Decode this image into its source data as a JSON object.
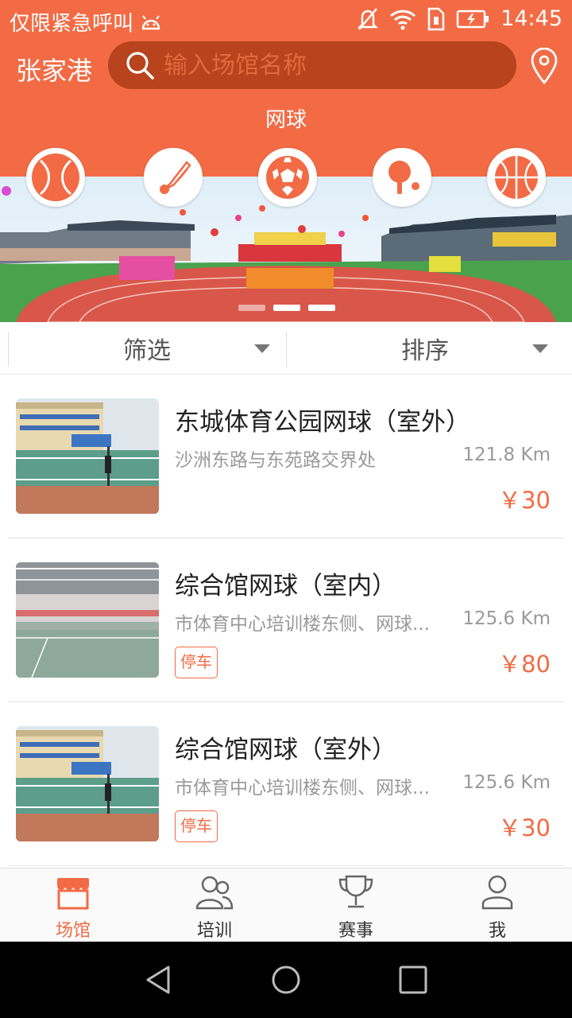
{
  "status_bar": {
    "carrier_text": "仅限紧急呼叫",
    "time": "14:45",
    "icons": [
      "android-icon",
      "mute-icon",
      "wifi-icon",
      "sim-icon",
      "battery-icon"
    ]
  },
  "header": {
    "city": "张家港",
    "search_placeholder": "输入场馆名称",
    "sport_label": "网球",
    "accent_color": "#f26b45"
  },
  "sport_icons": [
    "tennis-ball-icon",
    "badminton-icon",
    "soccer-ball-icon",
    "table-tennis-icon",
    "basketball-icon"
  ],
  "banner": {
    "slides": 3,
    "active_slide": 2
  },
  "filters": {
    "filter_label": "筛选",
    "sort_label": "排序"
  },
  "venues": [
    {
      "name": "东城体育公园网球（室外）",
      "address": "沙洲东路与东苑路交界处",
      "distance": "121.8 Km",
      "price": "￥30",
      "tag": ""
    },
    {
      "name": "综合馆网球（室内）",
      "address": "市体育中心培训楼东侧、网球...",
      "distance": "125.6 Km",
      "price": "￥80",
      "tag": "停车"
    },
    {
      "name": "综合馆网球（室外）",
      "address": "市体育中心培训楼东侧、网球...",
      "distance": "125.6 Km",
      "price": "￥30",
      "tag": "停车"
    }
  ],
  "tabs": [
    {
      "label": "场馆",
      "icon": "store-icon",
      "active": true
    },
    {
      "label": "培训",
      "icon": "people-icon",
      "active": false
    },
    {
      "label": "赛事",
      "icon": "trophy-icon",
      "active": false
    },
    {
      "label": "我",
      "icon": "person-icon",
      "active": false
    }
  ]
}
